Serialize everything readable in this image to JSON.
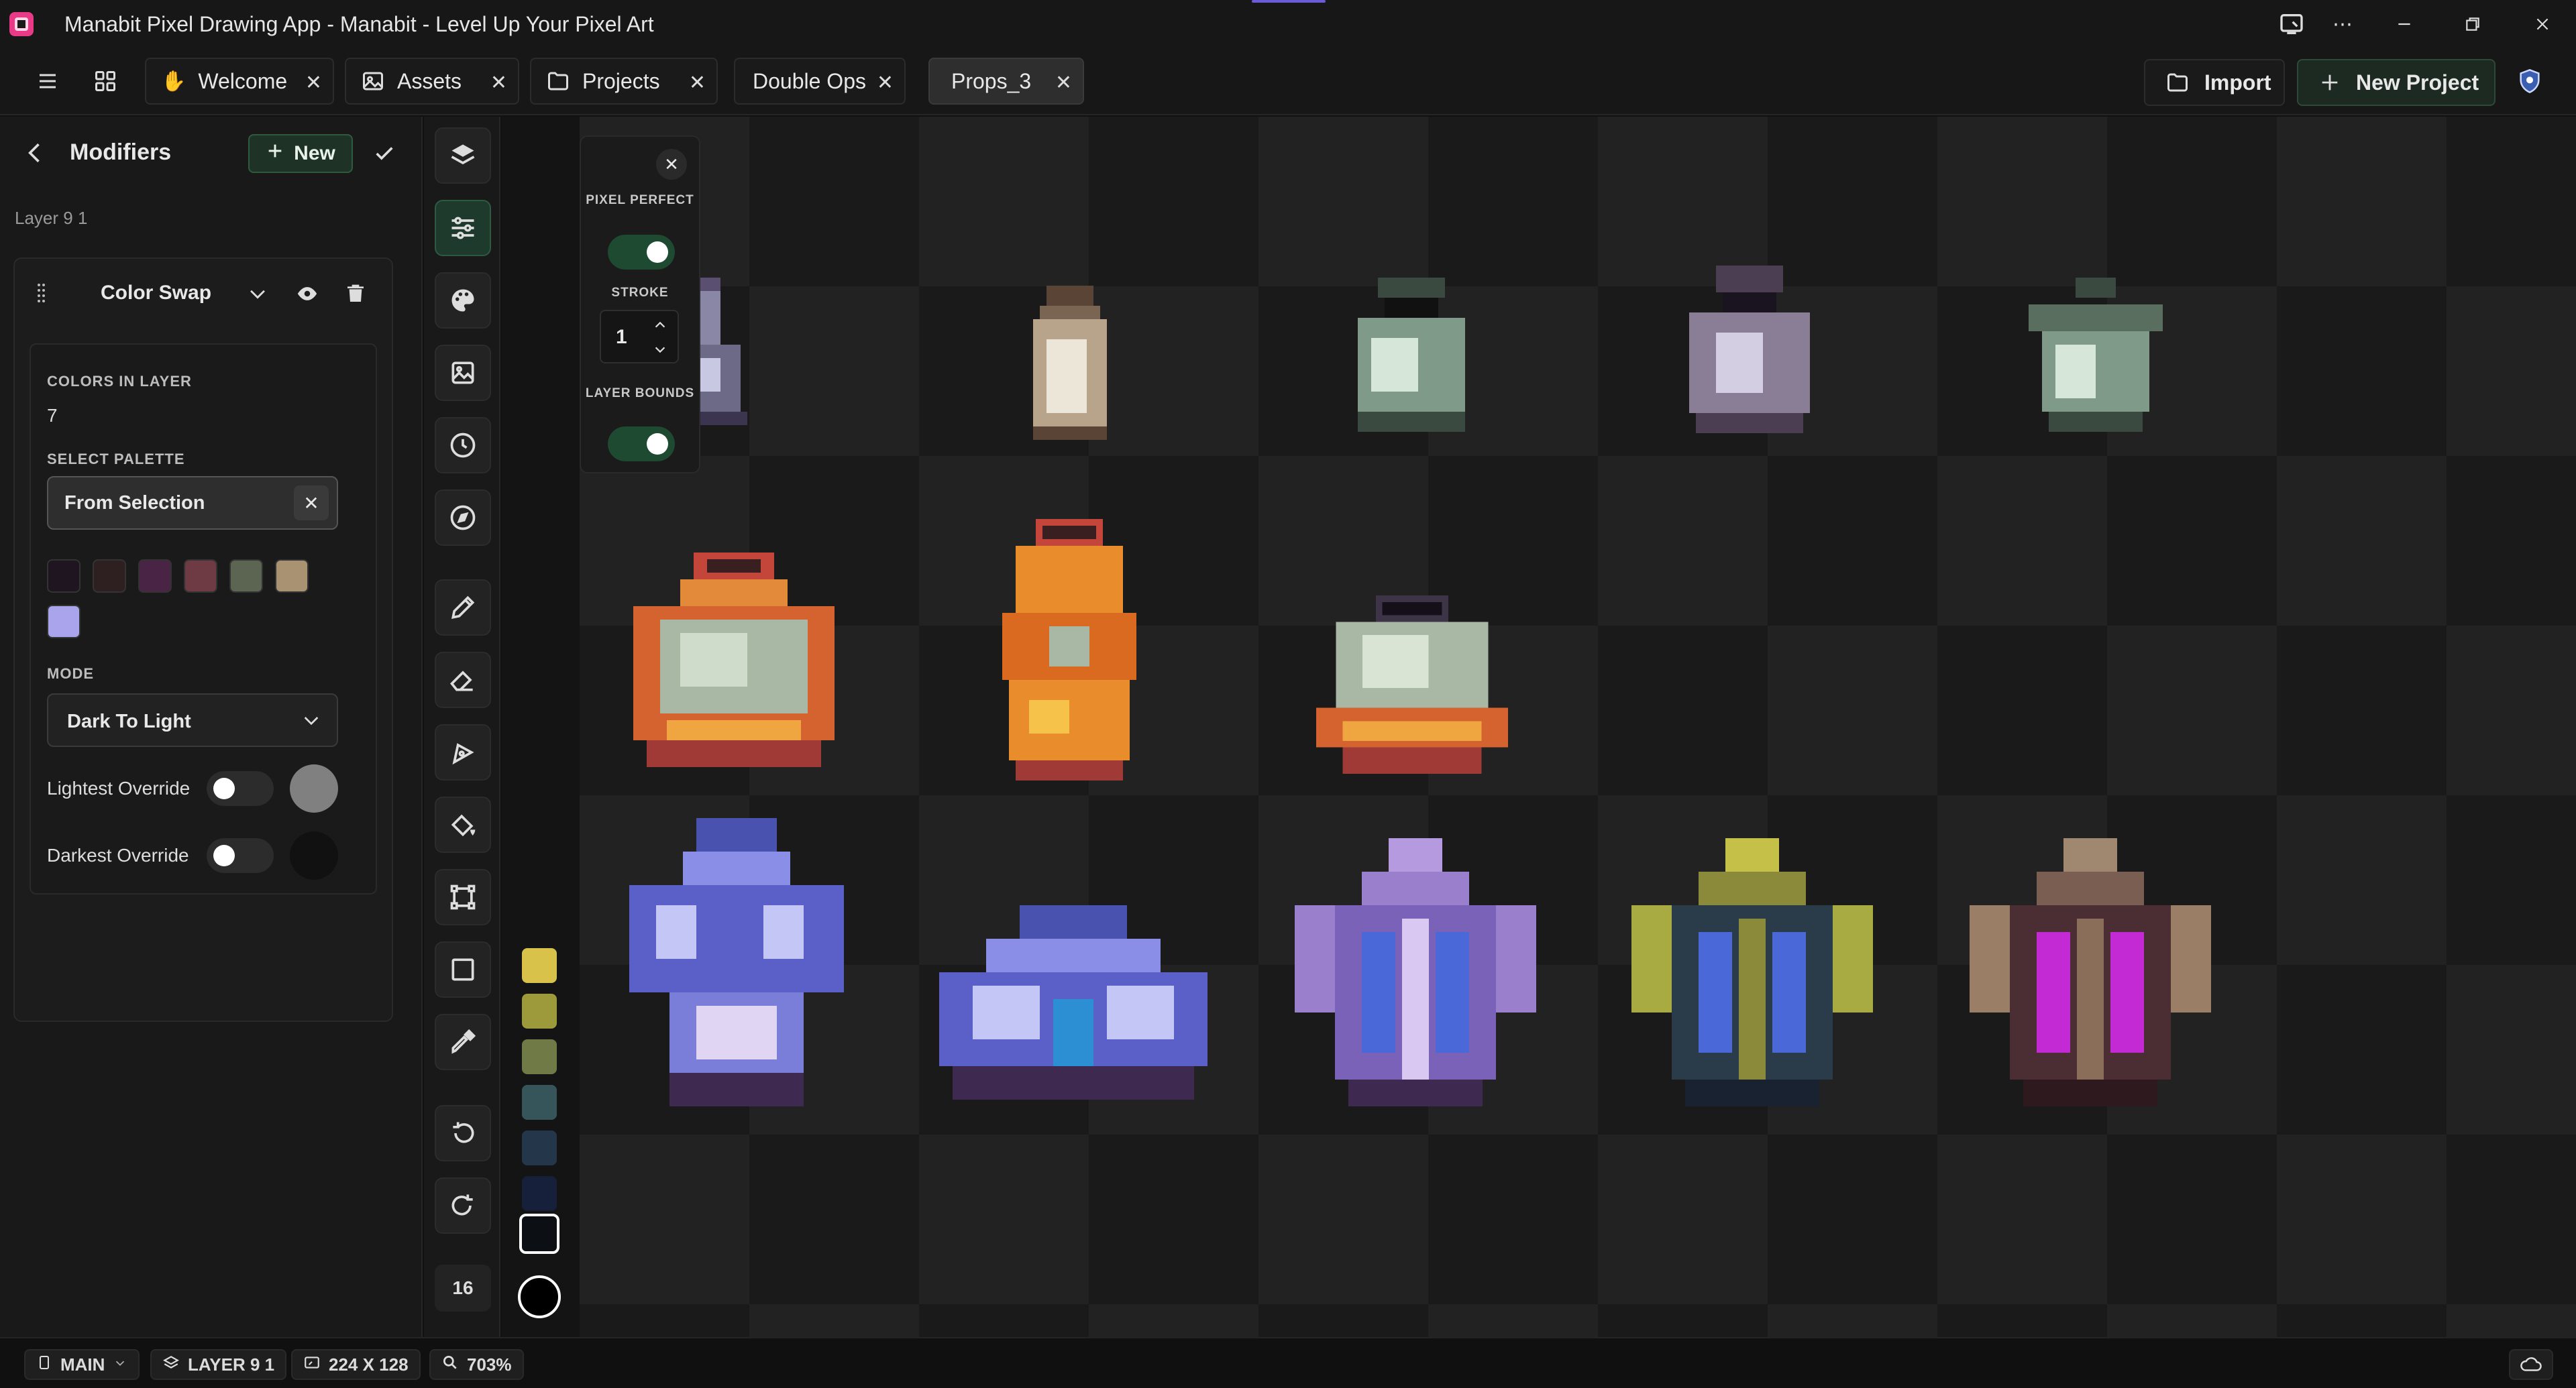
{
  "app": {
    "title": "Manabit Pixel Drawing App - Manabit - Level Up Your Pixel Art"
  },
  "tabs": [
    {
      "label": "Welcome",
      "icon": "wave-hand-icon",
      "active": false
    },
    {
      "label": "Assets",
      "icon": "image-icon",
      "active": false
    },
    {
      "label": "Projects",
      "icon": "folder-icon",
      "active": false
    },
    {
      "label": "Double Ops",
      "icon": "",
      "active": false
    },
    {
      "label": "Props_3",
      "icon": "",
      "active": true
    }
  ],
  "toolbar": {
    "import_label": "Import",
    "new_project_label": "New Project"
  },
  "modifiers": {
    "title": "Modifiers",
    "new_label": "New",
    "layer_name": "Layer 9 1",
    "modifier": {
      "name": "Color Swap",
      "colors_in_layer_label": "COLORS IN LAYER",
      "colors_in_layer_value": "7",
      "select_palette_label": "SELECT PALETTE",
      "palette_value": "From Selection",
      "palette_colors": [
        "#1e1520",
        "#2e2020",
        "#4a2444",
        "#6e3a44",
        "#5c6452",
        "#a89272",
        "#a9a4ec"
      ],
      "mode_label": "MODE",
      "mode_value": "Dark To Light",
      "lightest_override_label": "Lightest Override",
      "lightest_override_on": false,
      "lightest_override_color": "#808080",
      "darkest_override_label": "Darkest Override",
      "darkest_override_on": false,
      "darkest_override_color": "#111111"
    }
  },
  "tool_rail": {
    "brush_size": "16",
    "active_tool": "adjustments"
  },
  "swatch_rail": {
    "colors": [
      "#d9c24a",
      "#9c9a3a",
      "#6f7a46",
      "#36555a",
      "#23364a",
      "#16203a",
      "#0c0f14",
      "#000000"
    ]
  },
  "float_panel": {
    "pixel_perfect_label": "PIXEL PERFECT",
    "pixel_perfect_on": true,
    "stroke_label": "STROKE",
    "stroke_value": "1",
    "layer_bounds_label": "LAYER BOUNDS",
    "layer_bounds_on": true
  },
  "status": {
    "branch": "MAIN",
    "layer": "LAYER 9 1",
    "canvas_size": "224 X 128",
    "zoom": "703%"
  },
  "colors": {
    "accent_green": "#2f5a42",
    "background": "#111111"
  }
}
